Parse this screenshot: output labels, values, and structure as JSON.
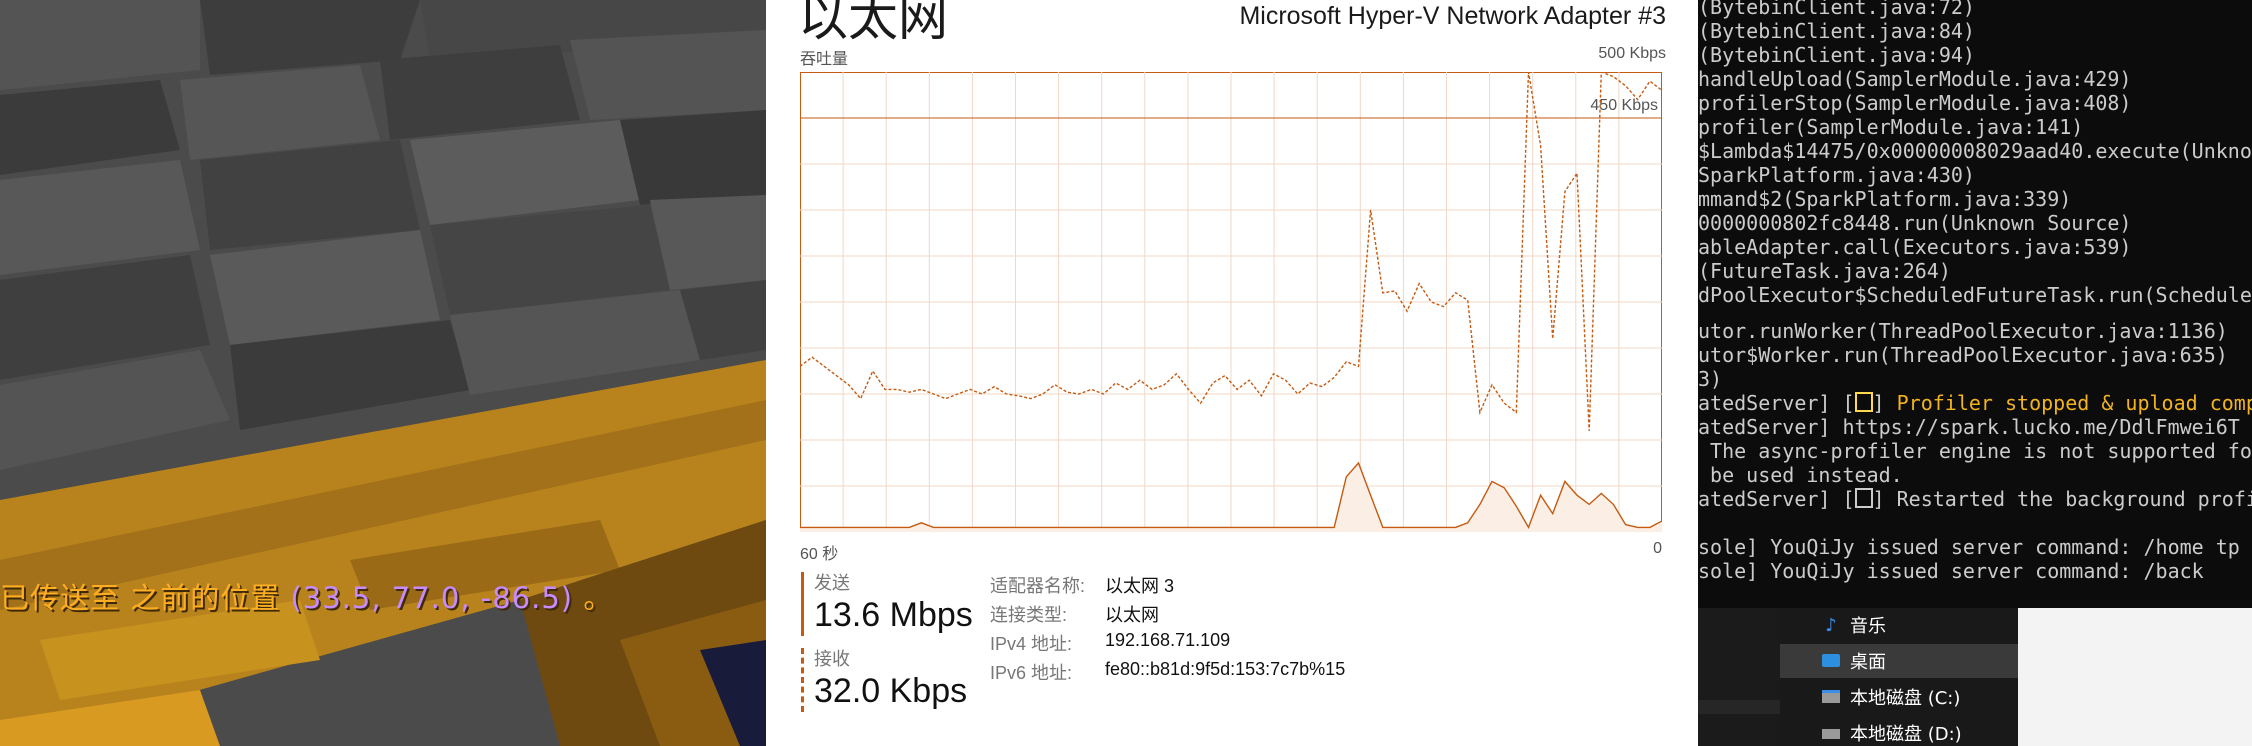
{
  "chat": {
    "prefix": "已传送至 之前的位置 ",
    "coords": "(33.5, 77.0, -86.5)",
    "suffix": " 。"
  },
  "task_manager": {
    "title": "以太网",
    "adapter": "Microsoft Hyper-V Network Adapter #3",
    "throughput_label": "吞吐量",
    "y_max_label": "500 Kbps",
    "scale_line_label": "450 Kbps",
    "x_left_label": "60 秒",
    "x_right_label": "0",
    "send": {
      "label": "发送",
      "value": "13.6 Mbps"
    },
    "receive": {
      "label": "接收",
      "value": "32.0 Kbps"
    },
    "properties": [
      {
        "key": "适配器名称:",
        "value": "以太网 3"
      },
      {
        "key": "连接类型:",
        "value": "以太网"
      },
      {
        "key": "IPv4 地址:",
        "value": "192.168.71.109"
      },
      {
        "key": "IPv6 地址:",
        "value": "fe80::b81d:9f5d:153:7c7b%15"
      }
    ],
    "colors": {
      "accent": "#c55a11",
      "grid": "#f1d7c6",
      "fill": "#fbeee4"
    }
  },
  "chart_data": {
    "type": "line",
    "ylim": [
      0,
      500
    ],
    "x_range_seconds": [
      60,
      0
    ],
    "series": [
      {
        "name": "发送",
        "values": [
          180,
          190,
          180,
          170,
          160,
          145,
          175,
          155,
          155,
          152,
          155,
          150,
          145,
          150,
          155,
          150,
          158,
          150,
          148,
          145,
          150,
          160,
          152,
          150,
          155,
          150,
          162,
          155,
          165,
          155,
          160,
          172,
          155,
          140,
          162,
          170,
          155,
          165,
          148,
          172,
          165,
          150,
          162,
          158,
          168,
          185,
          180,
          350,
          260,
          262,
          240,
          270,
          250,
          245,
          260,
          252,
          130,
          160,
          140,
          130,
          500,
          420,
          210,
          370,
          390,
          110,
          500,
          495,
          485,
          470,
          490,
          480
        ]
      },
      {
        "name": "接收",
        "values": [
          5,
          5,
          5,
          5,
          5,
          5,
          5,
          5,
          5,
          5,
          10,
          5,
          5,
          5,
          5,
          5,
          5,
          5,
          5,
          5,
          5,
          5,
          5,
          5,
          5,
          5,
          5,
          5,
          5,
          5,
          5,
          5,
          5,
          5,
          5,
          5,
          5,
          5,
          5,
          5,
          5,
          5,
          5,
          5,
          5,
          60,
          75,
          40,
          5,
          5,
          5,
          5,
          5,
          5,
          5,
          10,
          30,
          55,
          48,
          28,
          5,
          40,
          20,
          55,
          40,
          30,
          42,
          30,
          8,
          5,
          5,
          12
        ]
      }
    ]
  },
  "console": {
    "lines": [
      "(BytebinClient.java:72)",
      "(BytebinClient.java:84)",
      "(BytebinClient.java:94)",
      "handleUpload(SamplerModule.java:429)",
      "profilerStop(SamplerModule.java:408)",
      "profiler(SamplerModule.java:141)",
      "$Lambda$14475/0x00000008029aad40.execute(Unknown",
      "SparkPlatform.java:430)",
      "mmand$2(SparkPlatform.java:339)",
      "0000000802fc8448.run(Unknown Source)",
      "ableAdapter.call(Executors.java:539)",
      "(FutureTask.java:264)",
      "dPoolExecutor$ScheduledFutureTask.run(Scheduled",
      "",
      "utor.runWorker(ThreadPoolExecutor.java:1136)",
      "utor$Worker.run(ThreadPoolExecutor.java:635)",
      "3)"
    ],
    "profiler_stopped_prefix": "atedServer] [",
    "profiler_stopped_text": "Profiler stopped & upload comp",
    "url_line": "atedServer] https://spark.lucko.me/DdlFmwei6T",
    "warn_line1": " The async-profiler engine is not supported fo",
    "warn_line2": " be used instead.",
    "restarted_prefix": "atedServer] [",
    "restarted_text": "Restarted the background profi",
    "cmd1": "sole] YouQiJy issued server command: /home tp",
    "cmd2": "sole] YouQiJy issued server command: /back"
  },
  "explorer": {
    "items": [
      {
        "icon": "music-note-icon",
        "label": "音乐"
      },
      {
        "icon": "desktop-icon",
        "label": "桌面"
      },
      {
        "icon": "drive-icon",
        "label": "本地磁盘 (C:)"
      },
      {
        "icon": "drive-icon",
        "label": "本地磁盘 (D:)"
      }
    ]
  }
}
